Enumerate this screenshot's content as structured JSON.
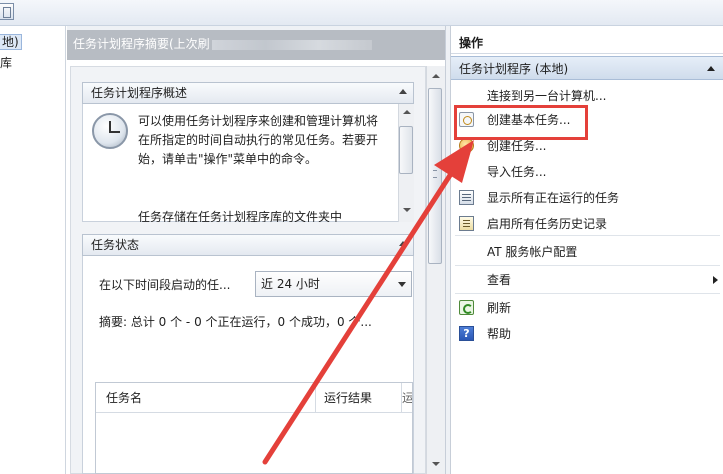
{
  "tree": {
    "item1": "地)",
    "item2": "库"
  },
  "center": {
    "header_title": "任务计划程序摘要(上次刷",
    "overview": {
      "title": "任务计划程序概述",
      "text": "可以使用任务计划程序来创建和管理计算机将在所指定的时间自动执行的常见任务。若要开始，请单击\"操作\"菜单中的命令。",
      "text2": "任务存储在任务计划程序库的文件夹中"
    },
    "status": {
      "title": "任务状态",
      "period_label": "在以下时间段启动的任...",
      "period_value": "近 24 小时",
      "summary": "摘要: 总计 0 个 - 0 个正在运行，0 个成功，0 个...",
      "columns": [
        "任务名",
        "运行结果",
        "运"
      ]
    }
  },
  "actions": {
    "title": "操作",
    "group": "任务计划程序 (本地)",
    "items": [
      {
        "label": "连接到另一台计算机...",
        "icon": "none"
      },
      {
        "label": "创建基本任务...",
        "icon": "basic-task-icon"
      },
      {
        "label": "创建任务...",
        "icon": "create-task-icon"
      },
      {
        "label": "导入任务...",
        "icon": "none"
      },
      {
        "label": "显示所有正在运行的任务",
        "icon": "running-tasks-icon"
      },
      {
        "label": "启用所有任务历史记录",
        "icon": "history-icon"
      },
      {
        "label": "AT 服务帐户配置",
        "icon": "none"
      },
      {
        "label": "查看",
        "icon": "none"
      },
      {
        "label": "刷新",
        "icon": "refresh-icon"
      },
      {
        "label": "帮助",
        "icon": "help-icon"
      }
    ],
    "help_glyph": "?"
  },
  "annotation": {
    "highlight_color": "#e4403a"
  }
}
